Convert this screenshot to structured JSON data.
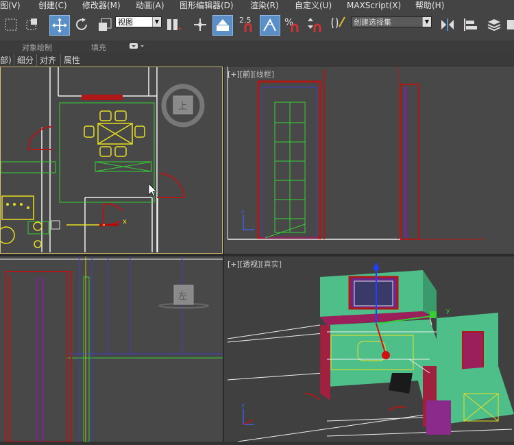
{
  "menu": {
    "items": [
      "图(V)",
      "创建(C)",
      "修改器(M)",
      "动画(A)",
      "图形编辑器(D)",
      "渲染(R)",
      "自定义(U)",
      "MAXScript(X)",
      "帮助(H)"
    ]
  },
  "toolbar": {
    "view_dropdown": "视图",
    "snap_value": "2.5",
    "named_selection": "创建选择集"
  },
  "ribbon": {
    "object_paint": "对象绘制",
    "fill": "填充"
  },
  "subtabs": [
    "部)",
    "细分",
    "对齐",
    "属性"
  ],
  "viewports": {
    "top_right": {
      "plus": "[+]",
      "view": "[前]",
      "mode": "[线框]"
    },
    "bottom_right": {
      "plus": "[+]",
      "view": "[透视]",
      "mode": "[真实]"
    },
    "viewcube_top": "上",
    "viewcube_left": "左"
  },
  "axis": {
    "x": "x",
    "y": "y",
    "z": "z"
  },
  "colors": {
    "accent_blue": "#5b8fc7",
    "wall_red": "#b01818",
    "floor_green": "#4fbf8a",
    "wire_green": "#35d035",
    "furniture_yellow": "#e8e020",
    "active_border": "#d8c070"
  }
}
